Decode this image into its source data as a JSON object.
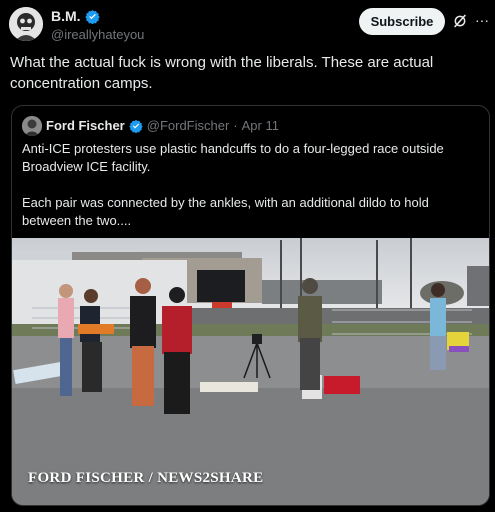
{
  "author": {
    "display_name": "B.M.",
    "handle": "@ireallyhateyou",
    "verified": true
  },
  "actions": {
    "subscribe_label": "Subscribe",
    "grok_icon": "grok-icon",
    "more_label": "···"
  },
  "post": {
    "text": "What the actual fuck is wrong with the liberals. These are actual concentration camps."
  },
  "quote": {
    "display_name": "Ford Fischer",
    "handle": "@FordFischer",
    "separator": "·",
    "date": "Apr 11",
    "verified": true,
    "paragraph_1": "Anti-ICE protesters use plastic handcuffs to do a four-legged race outside Broadview ICE facility.",
    "paragraph_2": "Each pair was connected by the ankles, with an additional dildo to hold between the two....",
    "media": {
      "watermark": "FORD FISCHER / NEWS2SHARE"
    }
  },
  "colors": {
    "background": "#000000",
    "text": "#e7e9ea",
    "secondary_text": "#71767b",
    "verified_blue": "#1d9bf0",
    "border": "#2f3336"
  }
}
